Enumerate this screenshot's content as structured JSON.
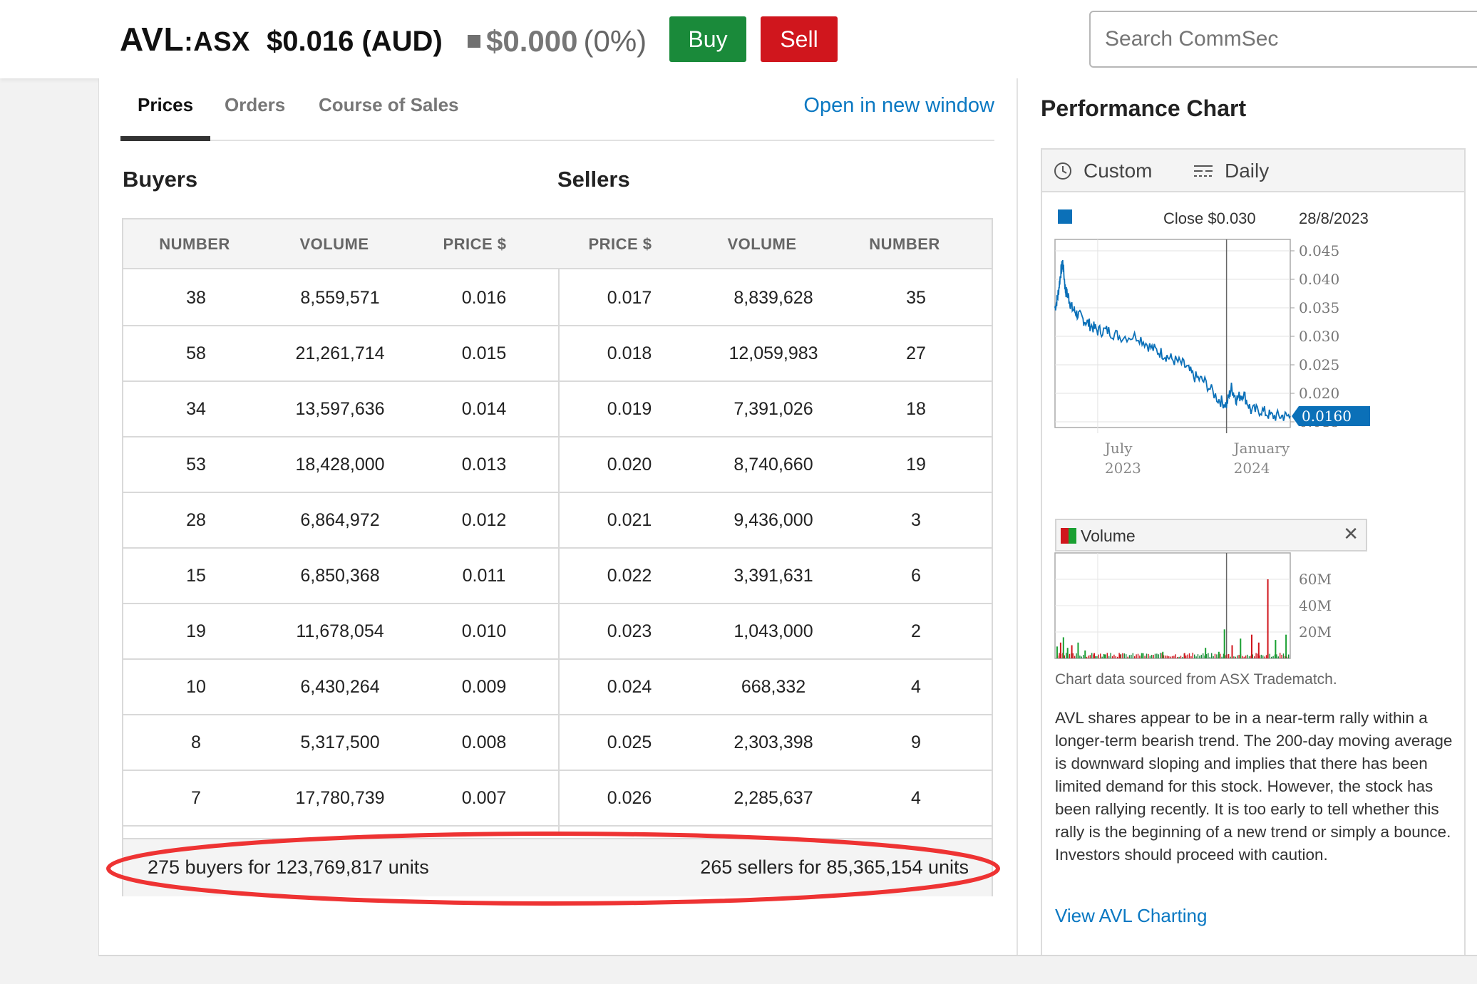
{
  "header": {
    "ticker": "AVL",
    "exchange": ":ASX",
    "price": "$0.016 (AUD)",
    "change_value": "$0.000",
    "change_pct": "(0%)",
    "buy_label": "Buy",
    "sell_label": "Sell",
    "search_placeholder": "Search CommSec"
  },
  "tabs": [
    {
      "label": "Prices",
      "active": true
    },
    {
      "label": "Orders",
      "active": false
    },
    {
      "label": "Course of Sales",
      "active": false
    }
  ],
  "open_new_window": "Open in new window",
  "buyers_heading": "Buyers",
  "sellers_heading": "Sellers",
  "depth_columns": [
    "NUMBER",
    "VOLUME",
    "PRICE $",
    "PRICE $",
    "VOLUME",
    "NUMBER"
  ],
  "depth_rows": [
    {
      "buy_number": "38",
      "buy_volume": "8,559,571",
      "buy_price": "0.016",
      "sell_price": "0.017",
      "sell_volume": "8,839,628",
      "sell_number": "35"
    },
    {
      "buy_number": "58",
      "buy_volume": "21,261,714",
      "buy_price": "0.015",
      "sell_price": "0.018",
      "sell_volume": "12,059,983",
      "sell_number": "27"
    },
    {
      "buy_number": "34",
      "buy_volume": "13,597,636",
      "buy_price": "0.014",
      "sell_price": "0.019",
      "sell_volume": "7,391,026",
      "sell_number": "18"
    },
    {
      "buy_number": "53",
      "buy_volume": "18,428,000",
      "buy_price": "0.013",
      "sell_price": "0.020",
      "sell_volume": "8,740,660",
      "sell_number": "19"
    },
    {
      "buy_number": "28",
      "buy_volume": "6,864,972",
      "buy_price": "0.012",
      "sell_price": "0.021",
      "sell_volume": "9,436,000",
      "sell_number": "3"
    },
    {
      "buy_number": "15",
      "buy_volume": "6,850,368",
      "buy_price": "0.011",
      "sell_price": "0.022",
      "sell_volume": "3,391,631",
      "sell_number": "6"
    },
    {
      "buy_number": "19",
      "buy_volume": "11,678,054",
      "buy_price": "0.010",
      "sell_price": "0.023",
      "sell_volume": "1,043,000",
      "sell_number": "2"
    },
    {
      "buy_number": "10",
      "buy_volume": "6,430,264",
      "buy_price": "0.009",
      "sell_price": "0.024",
      "sell_volume": "668,332",
      "sell_number": "4"
    },
    {
      "buy_number": "8",
      "buy_volume": "5,317,500",
      "buy_price": "0.008",
      "sell_price": "0.025",
      "sell_volume": "2,303,398",
      "sell_number": "9"
    },
    {
      "buy_number": "7",
      "buy_volume": "17,780,739",
      "buy_price": "0.007",
      "sell_price": "0.026",
      "sell_volume": "2,285,637",
      "sell_number": "4"
    }
  ],
  "summary": {
    "buyers": "275 buyers for 123,769,817 units",
    "sellers": "265 sellers for 85,365,154 units"
  },
  "performance": {
    "title": "Performance Chart",
    "range_label": "Custom",
    "interval_label": "Daily",
    "legend_close": "Close $0.030",
    "legend_date": "28/8/2023",
    "volume_label": "Volume",
    "source_note": "Chart data sourced from ASX Tradematch.",
    "description": "AVL shares appear to be in a near-term rally within a longer-term bearish trend. The 200-day moving average is downward sloping and implies that there has been limited demand for this stock. However, the stock has been rallying recently. It is too early to tell whether this rally is the beginning of a new trend or simply a bounce. Investors should proceed with caution.",
    "view_link": "View AVL Charting"
  },
  "colors": {
    "price_line": "#0b70b8",
    "buy": "#1a8a3a",
    "sell": "#d0161d",
    "link": "#0a78c2",
    "highlight_ellipse": "#ee3333"
  },
  "chart_data": [
    {
      "type": "line",
      "series": [
        {
          "name": "Close",
          "points": [
            [
              "2023-05-01",
              0.035
            ],
            [
              "2023-05-05",
              0.037
            ],
            [
              "2023-05-09",
              0.041
            ],
            [
              "2023-05-12",
              0.043
            ],
            [
              "2023-05-16",
              0.038
            ],
            [
              "2023-05-20",
              0.037
            ],
            [
              "2023-05-25",
              0.035
            ],
            [
              "2023-06-01",
              0.034
            ],
            [
              "2023-06-10",
              0.033
            ],
            [
              "2023-06-20",
              0.032
            ],
            [
              "2023-07-01",
              0.031
            ],
            [
              "2023-07-15",
              0.031
            ],
            [
              "2023-08-01",
              0.03
            ],
            [
              "2023-08-28",
              0.03
            ],
            [
              "2023-09-15",
              0.028
            ],
            [
              "2023-10-01",
              0.027
            ],
            [
              "2023-10-15",
              0.026
            ],
            [
              "2023-11-01",
              0.025
            ],
            [
              "2023-11-15",
              0.023
            ],
            [
              "2023-12-01",
              0.022
            ],
            [
              "2023-12-20",
              0.019
            ],
            [
              "2024-01-01",
              0.018
            ],
            [
              "2024-01-08",
              0.021
            ],
            [
              "2024-01-15",
              0.019
            ],
            [
              "2024-01-25",
              0.02
            ],
            [
              "2024-02-05",
              0.017
            ],
            [
              "2024-02-20",
              0.017
            ],
            [
              "2024-03-05",
              0.016
            ],
            [
              "2024-03-20",
              0.016
            ],
            [
              "2024-04-01",
              0.016
            ]
          ]
        }
      ],
      "y_ticks": [
        "0.045",
        "0.040",
        "0.035",
        "0.030",
        "0.025",
        "0.020",
        "0.015"
      ],
      "x_ticks": [
        {
          "month": "July",
          "year": "2023",
          "date": "2023-07-01"
        },
        {
          "month": "January",
          "year": "2024",
          "date": "2024-01-01"
        }
      ],
      "x_range": [
        "2023-05-01",
        "2024-04-01"
      ],
      "ylim": [
        0.014,
        0.047
      ],
      "last_value_label": "0.0160",
      "grid": true
    },
    {
      "type": "bar",
      "series": [
        {
          "name": "Volume",
          "points": [
            [
              "2023-05-03",
              9,
              "buy"
            ],
            [
              "2023-05-08",
              12,
              "sell"
            ],
            [
              "2023-05-12",
              16,
              "buy"
            ],
            [
              "2023-05-18",
              8,
              "buy"
            ],
            [
              "2023-05-24",
              10,
              "sell"
            ],
            [
              "2023-06-02",
              12,
              "buy"
            ],
            [
              "2023-06-12",
              6,
              "buy"
            ],
            [
              "2023-06-25",
              4,
              "sell"
            ],
            [
              "2023-07-10",
              3,
              "buy"
            ],
            [
              "2023-08-01",
              3,
              "sell"
            ],
            [
              "2023-09-01",
              4,
              "buy"
            ],
            [
              "2023-10-01",
              5,
              "buy"
            ],
            [
              "2023-11-01",
              4,
              "sell"
            ],
            [
              "2023-12-01",
              8,
              "buy"
            ],
            [
              "2023-12-20",
              5,
              "buy"
            ],
            [
              "2023-12-28",
              22,
              "buy"
            ],
            [
              "2024-01-08",
              10,
              "sell"
            ],
            [
              "2024-01-20",
              15,
              "buy"
            ],
            [
              "2024-02-05",
              18,
              "sell"
            ],
            [
              "2024-02-15",
              12,
              "sell"
            ],
            [
              "2024-02-28",
              60,
              "sell"
            ],
            [
              "2024-03-10",
              14,
              "buy"
            ],
            [
              "2024-03-25",
              18,
              "buy"
            ]
          ]
        }
      ],
      "y_ticks": [
        "60M",
        "40M",
        "20M"
      ],
      "x_range": [
        "2023-05-01",
        "2024-04-01"
      ],
      "ylim": [
        0,
        80
      ]
    }
  ]
}
